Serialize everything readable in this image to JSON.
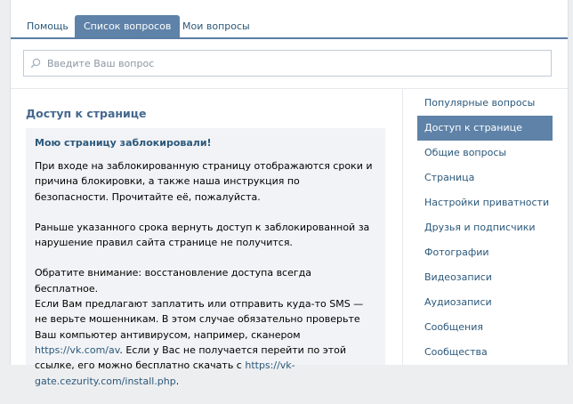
{
  "tabs": [
    {
      "label": "Помощь"
    },
    {
      "label": "Список вопросов"
    },
    {
      "label": "Мои вопросы"
    }
  ],
  "search": {
    "placeholder": "Введите Ваш вопрос"
  },
  "main": {
    "heading": "Доступ к странице",
    "question_title": "Мою страницу заблокировали!",
    "p1": "При входе на заблокированную страницу отображаются сроки и причина блокировки, а также наша инструкция по безопасности. Прочитайте её, пожалуйста.",
    "p2": "Раньше указанного срока вернуть доступ к заблокированной за нарушение правил сайта странице не получится.",
    "p3_line1": "Обратите внимание: восстановление доступа всегда бесплатное.",
    "p3_line2": "Если Вам предлагают заплатить или отправить куда-то SMS — не верьте мошенникам. В этом случае обязательно проверьте Ваш компьютер антивирусом, например, сканером ",
    "p3_link1": "https://vk.com/av",
    "p3_line3": ". Если у Вас не получается перейти по этой ссылке, его можно бесплатно скачать с ",
    "p3_link2": "https://vk-gate.cezurity.com/install.php",
    "p3_end": "."
  },
  "sidebar": {
    "items": [
      {
        "label": "Популярные вопросы"
      },
      {
        "label": "Доступ к странице"
      },
      {
        "label": "Общие вопросы"
      },
      {
        "label": "Страница"
      },
      {
        "label": "Настройки приватности"
      },
      {
        "label": "Друзья и подписчики"
      },
      {
        "label": "Фотографии"
      },
      {
        "label": "Видеозаписи"
      },
      {
        "label": "Аудиозаписи"
      },
      {
        "label": "Сообщения"
      },
      {
        "label": "Сообщества"
      }
    ]
  },
  "colors": {
    "accent": "#5e82a8",
    "link": "#2b587a",
    "heading": "#45688e"
  }
}
